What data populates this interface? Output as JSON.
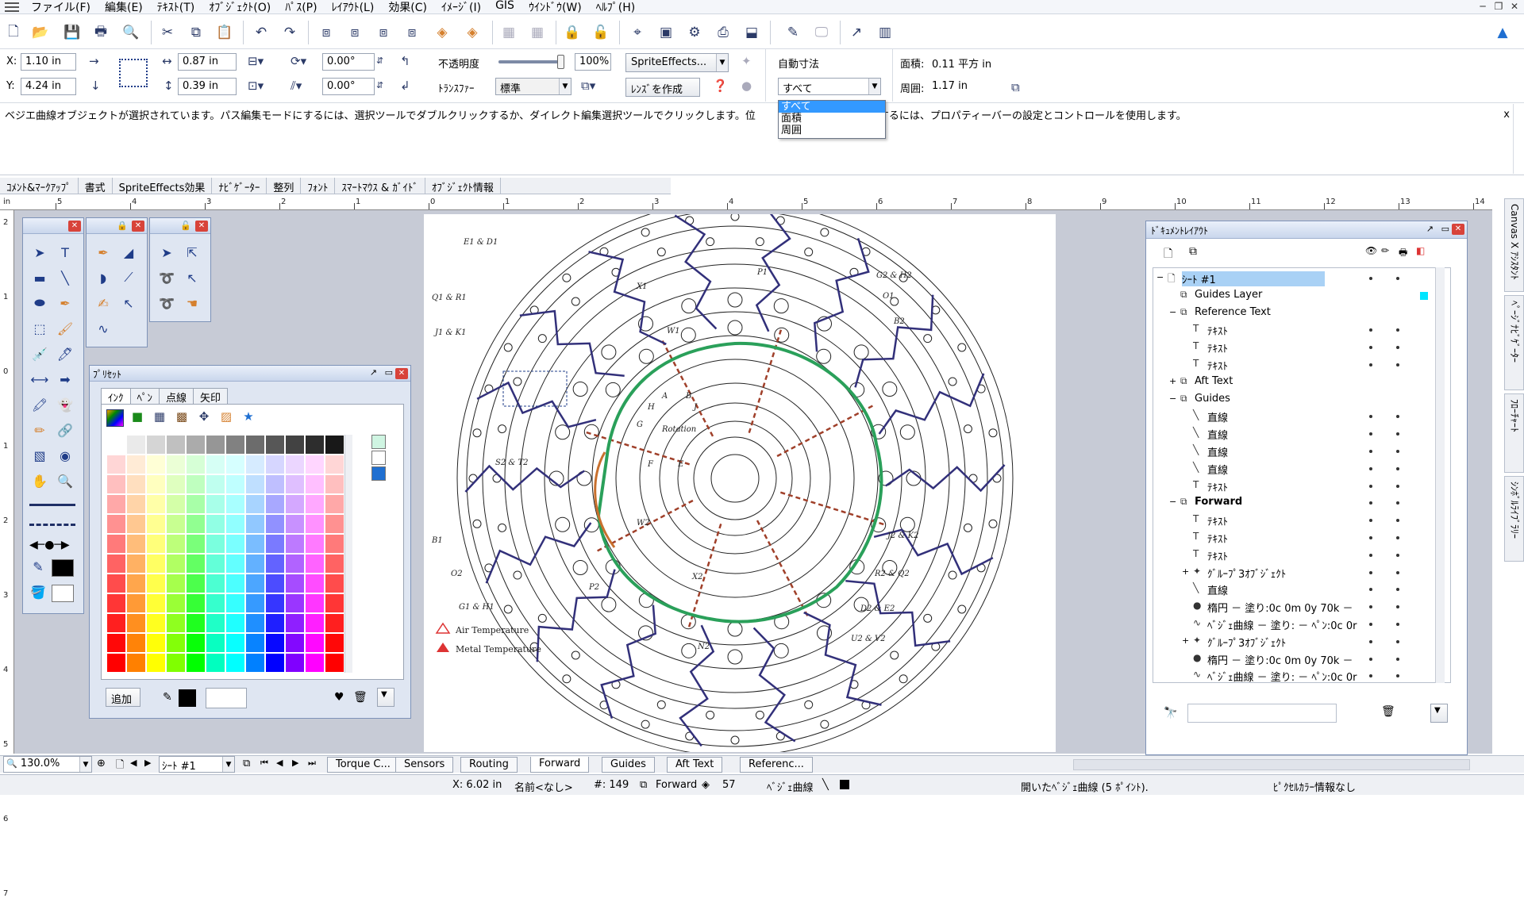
{
  "menu": [
    "ファイル(F)",
    "編集(E)",
    "ﾃｷｽﾄ(T)",
    "ｵﾌﾞｼﾞｪｸﾄ(O)",
    "ﾊﾟｽ(P)",
    "ﾚｲｱｳﾄ(L)",
    "効果(C)",
    "ｲﾒｰｼﾞ(I)",
    "GIS",
    "ｳｲﾝﾄﾞｳ(W)",
    "ﾍﾙﾌﾟ(H)"
  ],
  "props": {
    "x_label": "X:",
    "x_value": "1.10 in",
    "y_label": "Y:",
    "y_value": "4.24 in",
    "w_value": "0.87 in",
    "h_value": "0.39 in",
    "rot_value": "0.00°",
    "skew_value": "0.00°",
    "opacity_label": "不透明度",
    "opacity_value": "100%",
    "opacity_level": 1.0,
    "transfer_label": "ﾄﾗﾝｽﾌｧｰ",
    "transfer_value": "標準",
    "sprite_btn": "SpriteEffects...",
    "lens_btn": "ﾚﾝｽﾞを作成",
    "autodim_label": "自動寸法",
    "autodim_value": "すべて",
    "area_label": "面積:",
    "area_value": "0.11  平方 in",
    "perim_label": "周囲:",
    "perim_value": "1.17  in"
  },
  "dropdown": {
    "options": [
      "すべて",
      "面積",
      "周囲"
    ],
    "selected": 0
  },
  "info": {
    "text": "ベジエ曲線オブジェクトが選択されています。パス編集モードにするには、選択ツールでダブルクリックするか、ダイレクト編集選択ツールでクリックします。位",
    "text_tail": "更するには、プロパティーバーの設定とコントロールを使用します。",
    "close": "x"
  },
  "tabs": [
    "ｺﾒﾝﾄ&ﾏｰｸｱｯﾌﾟ",
    "書式",
    "SpriteEffects効果",
    "ﾅﾋﾞｹﾞｰﾀｰ",
    "整列",
    "ﾌｫﾝﾄ",
    "ｽﾏｰﾄﾏｳｽ & ｶﾞｲﾄﾞ",
    "ｵﾌﾞｼﾞｪｸﾄ情報"
  ],
  "ruler": {
    "unit": "in",
    "h_labels": [
      "5",
      "4",
      "3",
      "2",
      "1",
      "0",
      "1",
      "2",
      "3",
      "4",
      "5",
      "6",
      "7",
      "8",
      "9",
      "10",
      "11",
      "12",
      "13",
      "14"
    ],
    "v_labels": [
      "2",
      "1",
      "0",
      "1",
      "2",
      "3",
      "4",
      "5",
      "6",
      "7"
    ]
  },
  "preset": {
    "title": "ﾌﾟﾘｾｯﾄ",
    "tabs": [
      "ｲﾝｸ",
      "ﾍﾟﾝ",
      "点線",
      "矢印"
    ],
    "add_btn": "追加",
    "colors": [
      "#ff8800",
      "#00aa00",
      "#ff00ff",
      "#00ccff",
      "#ffff00",
      "#ff0000"
    ]
  },
  "doclayout": {
    "title": "ﾄﾞｷｭﾒﾝﾄﾚｲｱｳﾄ",
    "rows": [
      {
        "label": "ｼｰﾄ #1",
        "indent": 0,
        "expand": "−",
        "icon": "page",
        "selected": true,
        "bold": false
      },
      {
        "label": "Guides Layer",
        "indent": 1,
        "expand": "",
        "icon": "layer",
        "selected": false,
        "bold": false
      },
      {
        "label": "Reference Text",
        "indent": 1,
        "expand": "−",
        "icon": "layer",
        "selected": false,
        "bold": false
      },
      {
        "label": "ﾃｷｽﾄ",
        "indent": 2,
        "expand": "",
        "icon": "T",
        "selected": false,
        "bold": false
      },
      {
        "label": "ﾃｷｽﾄ",
        "indent": 2,
        "expand": "",
        "icon": "T",
        "selected": false,
        "bold": false
      },
      {
        "label": "ﾃｷｽﾄ",
        "indent": 2,
        "expand": "",
        "icon": "T",
        "selected": false,
        "bold": false
      },
      {
        "label": "Aft Text",
        "indent": 1,
        "expand": "+",
        "icon": "layer",
        "selected": false,
        "bold": false
      },
      {
        "label": "Guides",
        "indent": 1,
        "expand": "−",
        "icon": "layer",
        "selected": false,
        "bold": false
      },
      {
        "label": "直線",
        "indent": 2,
        "expand": "",
        "icon": "line",
        "selected": false,
        "bold": false
      },
      {
        "label": "直線",
        "indent": 2,
        "expand": "",
        "icon": "line",
        "selected": false,
        "bold": false
      },
      {
        "label": "直線",
        "indent": 2,
        "expand": "",
        "icon": "line",
        "selected": false,
        "bold": false
      },
      {
        "label": "直線",
        "indent": 2,
        "expand": "",
        "icon": "line",
        "selected": false,
        "bold": false
      },
      {
        "label": "ﾃｷｽﾄ",
        "indent": 2,
        "expand": "",
        "icon": "T",
        "selected": false,
        "bold": false
      },
      {
        "label": "Forward",
        "indent": 1,
        "expand": "−",
        "icon": "layer",
        "selected": false,
        "bold": true
      },
      {
        "label": "ﾃｷｽﾄ",
        "indent": 2,
        "expand": "",
        "icon": "T",
        "selected": false,
        "bold": false
      },
      {
        "label": "ﾃｷｽﾄ",
        "indent": 2,
        "expand": "",
        "icon": "T",
        "selected": false,
        "bold": false
      },
      {
        "label": "ﾃｷｽﾄ",
        "indent": 2,
        "expand": "",
        "icon": "T",
        "selected": false,
        "bold": false
      },
      {
        "label": "ｸﾞﾙｰﾌﾟ3ｵﾌﾞｼﾞｪｸﾄ",
        "indent": 2,
        "expand": "+",
        "icon": "group",
        "selected": false,
        "bold": false
      },
      {
        "label": "直線",
        "indent": 2,
        "expand": "",
        "icon": "line",
        "selected": false,
        "bold": false
      },
      {
        "label": "楕円 － 塗り:0c 0m 0y 70k －",
        "indent": 2,
        "expand": "",
        "icon": "ellipse",
        "selected": false,
        "bold": false
      },
      {
        "label": "ﾍﾞｼﾞｪ曲線 － 塗り: － ﾍﾟﾝ:0c 0r",
        "indent": 2,
        "expand": "",
        "icon": "bezier",
        "selected": false,
        "bold": false
      },
      {
        "label": "ｸﾞﾙｰﾌﾟ3ｵﾌﾞｼﾞｪｸﾄ",
        "indent": 2,
        "expand": "+",
        "icon": "group",
        "selected": false,
        "bold": false
      },
      {
        "label": "楕円 － 塗り:0c 0m 0y 70k －",
        "indent": 2,
        "expand": "",
        "icon": "ellipse",
        "selected": false,
        "bold": false
      },
      {
        "label": "ﾍﾞｼﾞｪ曲線 － 塗り: － ﾍﾟﾝ:0c 0r",
        "indent": 2,
        "expand": "",
        "icon": "bezier",
        "selected": false,
        "bold": false
      }
    ]
  },
  "sidetabs": [
    "Canvas X ｱｼｽﾀﾝﾄ",
    "ﾍﾟｰｼﾞﾅﾋﾞｹﾞｰﾀｰ",
    "ﾌﾛｰﾁｬｰﾄ",
    "ｼﾝﾎﾞﾙﾗｲﾌﾞﾗﾘｰ"
  ],
  "drawing": {
    "labels": [
      "E1 & D1",
      "Q1 & R1",
      "J1 & K1",
      "S2 & T2",
      "B1",
      "O2",
      "G1 & H1",
      "P1",
      "O1",
      "G2 & H2",
      "B2",
      "J2 & K2",
      "R2 & Q2",
      "D2 & E2",
      "U2 & V2",
      "N2",
      "W1",
      "W2",
      "X1",
      "X2",
      "P2",
      "Rotation",
      "A",
      "B",
      "E",
      "F",
      "G",
      "H",
      "J"
    ],
    "legend": [
      "Air Temperature",
      "Metal Temperature"
    ]
  },
  "pagebar": {
    "zoom": "130.0%",
    "sheet": "ｼｰﾄ #1",
    "tabs": [
      "Torque C...",
      "Sensors",
      "Routing",
      "Forward",
      "Guides",
      "Aft Text",
      "Referenc..."
    ],
    "active": "Forward"
  },
  "status": {
    "x": "X: 6.02 in",
    "name": "名前<なし>",
    "id": "#: 149",
    "layer": "Forward",
    "count": "57",
    "type": "ﾍﾞｼﾞｪ曲線",
    "desc": "開いたﾍﾞｼﾞｪ曲線 (5 ﾎﾟｲﾝﾄ).",
    "pixel": "ﾋﾟｸｾﾙｶﾗｰ情報なし"
  }
}
